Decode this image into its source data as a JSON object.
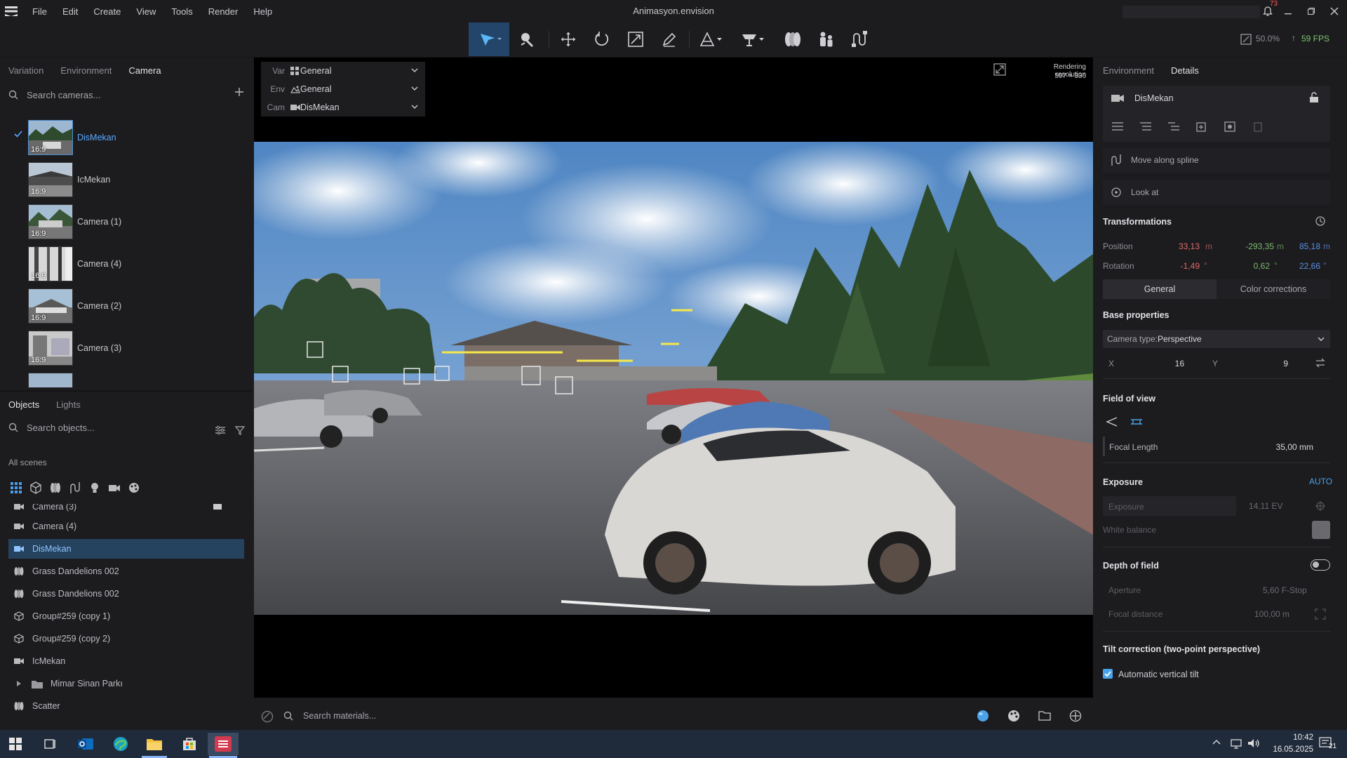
{
  "app": {
    "title": "Animasyon.envision",
    "menu": [
      "File",
      "Edit",
      "Create",
      "View",
      "Tools",
      "Render",
      "Help"
    ],
    "notification_count": "73"
  },
  "toolbar": {
    "zoom": "50.0%",
    "fps": "59 FPS",
    "tools": [
      "select",
      "paint",
      "move",
      "rotate",
      "scale",
      "edit",
      "terrain",
      "asset",
      "vegetation",
      "people",
      "spline"
    ]
  },
  "left_top": {
    "tabs": [
      "Variation",
      "Environment",
      "Camera"
    ],
    "active_tab": "Camera",
    "search_placeholder": "Search cameras...",
    "cameras": [
      {
        "name": "DisMekan",
        "ratio": "16:9",
        "selected": true
      },
      {
        "name": "IcMekan",
        "ratio": "16:9"
      },
      {
        "name": "Camera (1)",
        "ratio": "16:9"
      },
      {
        "name": "Camera (4)",
        "ratio": "16:9"
      },
      {
        "name": "Camera (2)",
        "ratio": "16:9"
      },
      {
        "name": "Camera (3)",
        "ratio": "16:9"
      }
    ]
  },
  "left_bottom": {
    "tabs": [
      "Objects",
      "Lights"
    ],
    "active_tab": "Objects",
    "search_placeholder": "Search objects...",
    "scene_label": "All scenes",
    "filters": [
      "all",
      "object",
      "vegetation",
      "spline",
      "light",
      "camera",
      "material"
    ],
    "items": [
      {
        "label": "Camera (3)",
        "icon": "camera"
      },
      {
        "label": "Camera (4)",
        "icon": "camera"
      },
      {
        "label": "DisMekan",
        "icon": "camera",
        "selected": true
      },
      {
        "label": "Grass Dandelions 002",
        "icon": "vegetation"
      },
      {
        "label": "Grass Dandelions 002",
        "icon": "vegetation"
      },
      {
        "label": "Group#259 (copy 1)",
        "icon": "object"
      },
      {
        "label": "Group#259 (copy 2)",
        "icon": "object"
      },
      {
        "label": "IcMekan",
        "icon": "camera"
      },
      {
        "label": "Mimar Sinan Parkı",
        "icon": "folder"
      },
      {
        "label": "Scatter",
        "icon": "vegetation"
      }
    ]
  },
  "viewport": {
    "dropdowns": [
      {
        "key": "Var",
        "value": "General"
      },
      {
        "key": "Env",
        "value": "General"
      },
      {
        "key": "Cam",
        "value": "DisMekan"
      }
    ],
    "render_res_label": "Rendering resolution",
    "render_res_value": "597 × 336",
    "material_search_placeholder": "Search materials..."
  },
  "right": {
    "tabs": [
      "Environment",
      "Details"
    ],
    "active_tab": "Details",
    "object_name": "DisMekan",
    "move_along_spline": "Move along spline",
    "look_at": "Look at",
    "transformations": "Transformations",
    "position_label": "Position",
    "position": [
      "33,13",
      "-293,35",
      "85,18"
    ],
    "rotation_label": "Rotation",
    "rotation": [
      "-1,49",
      "0,62",
      "22,66"
    ],
    "unit_m": "m",
    "unit_deg": "°",
    "subtabs": [
      "General",
      "Color corrections"
    ],
    "base_properties": "Base properties",
    "camera_type_label": "Camera type:",
    "camera_type": "Perspective",
    "x_label": "X",
    "x_value": "16",
    "y_label": "Y",
    "y_value": "9",
    "fov": "Field of view",
    "focal_label": "Focal Length",
    "focal_value": "35,00 mm",
    "exposure": "Exposure",
    "exposure_auto": "AUTO",
    "exposure_field": "Exposure",
    "exposure_value": "14,11 EV",
    "white_balance": "White balance",
    "dof": "Depth of field",
    "aperture_label": "Aperture",
    "aperture_value": "5,60 F-Stop",
    "focal_distance_label": "Focal distance",
    "focal_distance_value": "100,00 m",
    "tilt": "Tilt correction (two-point perspective)",
    "auto_tilt": "Automatic vertical tilt",
    "auto_tilt_checked": true
  },
  "taskbar": {
    "time": "10:42",
    "date": "16.05.2025",
    "notif": "21"
  },
  "colors": {
    "accent": "#4aa3e8",
    "x": "#e06a6a",
    "y": "#7ab86a",
    "z": "#5a8fe0",
    "selected_row": "#25425e"
  }
}
